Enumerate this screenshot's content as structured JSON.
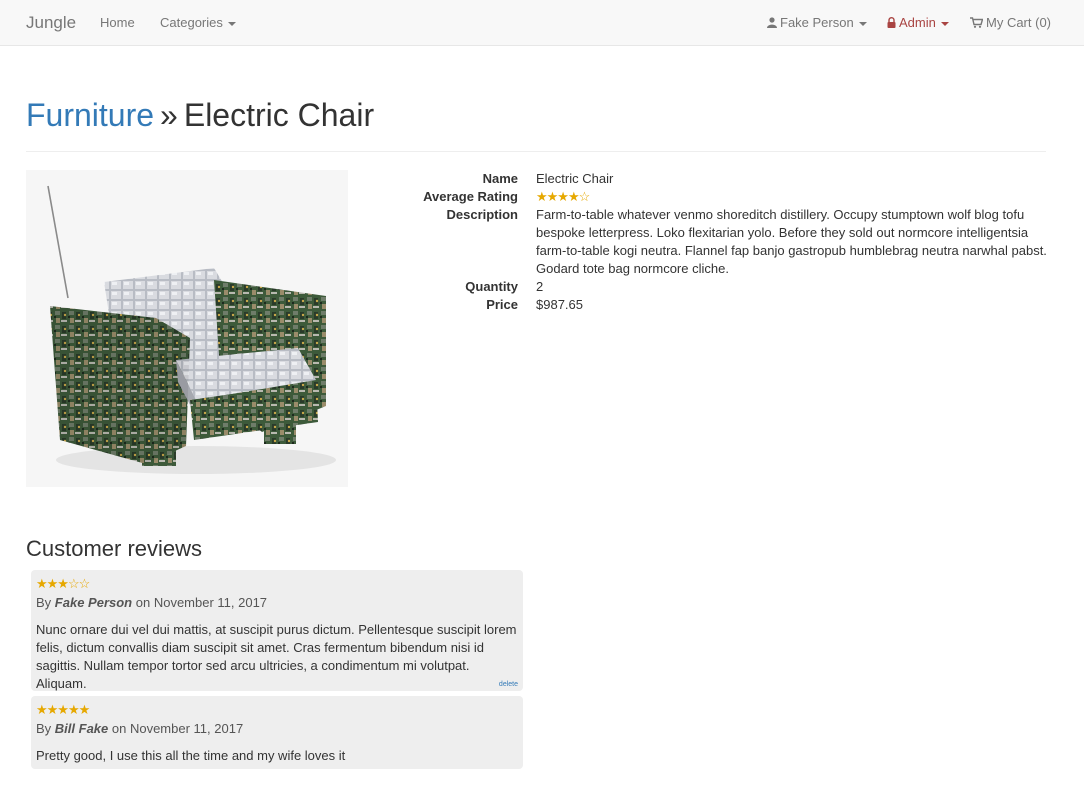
{
  "navbar": {
    "brand": "Jungle",
    "home": "Home",
    "categories": "Categories",
    "user": "Fake Person",
    "admin": "Admin",
    "cart": "My Cart (0)"
  },
  "breadcrumb": {
    "category": "Furniture",
    "separator": "»",
    "product": "Electric Chair"
  },
  "product": {
    "image_alt": "Electric chair built from circuit boards",
    "labels": {
      "name": "Name",
      "rating": "Average Rating",
      "description": "Description",
      "quantity": "Quantity",
      "price": "Price"
    },
    "name": "Electric Chair",
    "rating_stars": "★★★★☆",
    "rating": 4,
    "description": "Farm-to-table whatever venmo shoreditch distillery. Occupy stumptown wolf blog tofu bespoke letterpress. Loko flexitarian yolo. Before they sold out normcore intelligentsia farm-to-table kogi neutra. Flannel fap banjo gastropub humblebrag neutra narwhal pabst. Godard tote bag normcore cliche.",
    "quantity": "2",
    "price": "$987.65"
  },
  "reviews": {
    "title": "Customer reviews",
    "items": [
      {
        "stars": "★★★☆☆",
        "rating": 3,
        "by": "By",
        "author": "Fake Person",
        "on": "on November 11, 2017",
        "body": "Nunc ornare dui vel dui mattis, at suscipit purus dictum. Pellentesque suscipit lorem felis, dictum convallis diam suscipit sit amet. Cras fermentum bibendum nisi id sagittis. Nullam tempor tortor sed arcu ultricies, a condimentum mi volutpat. Aliquam.",
        "delete": "delete"
      },
      {
        "stars": "★★★★★",
        "rating": 5,
        "by": "By",
        "author": "Bill Fake",
        "on": "on November 11, 2017",
        "body": "Pretty good, I use this all the time and my wife loves it"
      }
    ]
  },
  "colors": {
    "link": "#337ab7",
    "admin": "#a94442",
    "star": "#e6a800",
    "navbar_bg": "#f8f8f8",
    "review_bg": "#eeeeee"
  }
}
